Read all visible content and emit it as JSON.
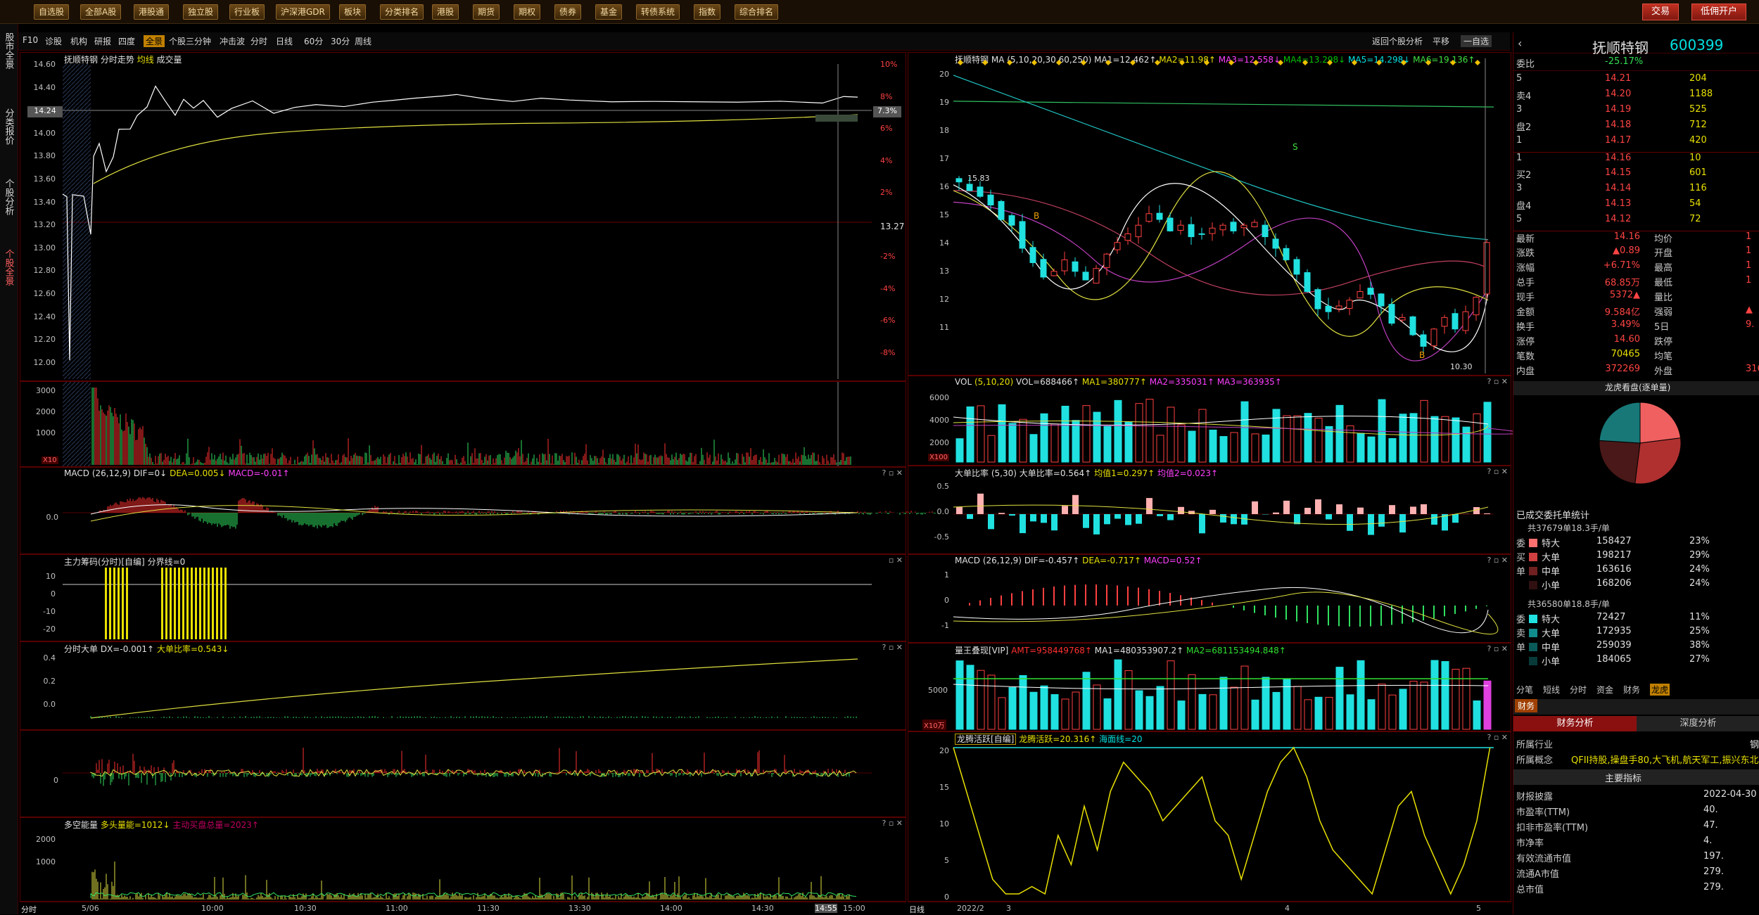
{
  "toolbar": {
    "items": [
      "自选股",
      "全部A股",
      "港股通",
      "独立股",
      "行业板",
      "沪深港GDR",
      "板块",
      "分类排名",
      "港股",
      "期货",
      "期权",
      "债券",
      "基金",
      "转债系统",
      "指数",
      "综合排名"
    ],
    "trade": "交易",
    "open_account": "低佣开户"
  },
  "left_nav": {
    "tabs": [
      "股市全景",
      "分类报价",
      "个股分析",
      "个股全景"
    ]
  },
  "row2": {
    "items": [
      "F10",
      "诊股",
      "机构",
      "研报",
      "四度",
      "全景",
      "个股三分钟",
      "冲击波",
      "分时",
      "日线",
      "60分",
      "30分",
      "周线"
    ],
    "right": [
      "返回个股分析",
      "平移",
      "一自选"
    ]
  },
  "intraday": {
    "title": "抚顺特钢",
    "sub1": "分时走势",
    "sub2": "均线",
    "sub3": "成交量",
    "price_ticks": [
      "14.60",
      "14.40",
      "14.20",
      "14.00",
      "13.80",
      "13.60",
      "13.40",
      "13.20",
      "13.00",
      "12.80",
      "12.60",
      "12.40",
      "12.20",
      "12.00"
    ],
    "pct_ticks": [
      "10%",
      "8%",
      "6%",
      "4%",
      "2%",
      "",
      "-2%",
      "-4%",
      "-6%",
      "-8%"
    ],
    "last_price": "14.24",
    "last_pct": "7.3%",
    "prev_close": "13.27",
    "vol_ticks": [
      "3000",
      "2000",
      "1000"
    ],
    "vol_unit": "X10",
    "macd_title": "MACD",
    "macd_params": "(26,12,9)",
    "macd_dif": "DIF=0↓",
    "macd_dea": "DEA=0.005↓",
    "macd_macd": "MACD=-0.01↑",
    "macd_tick": "0.0",
    "chip_title": "主力筹码(分时)[自编]",
    "chip_val": "分界线=0",
    "chip_ticks": [
      "10",
      "0",
      "-10",
      "-20"
    ],
    "big_title": "分时大单",
    "big_dx": "DX=-0.001↑",
    "big_ratio": "大单比率=0.543↓",
    "big_ticks": [
      "0.4",
      "0.2",
      "0.0"
    ],
    "osc_tick": "0",
    "dk_title": "多空能量",
    "dk_long": "多头量能=1012↓",
    "dk_short": "主动买盘总量=2023↑",
    "dk_ticks": [
      "2000",
      "1000"
    ],
    "x_ticks": [
      "5/06",
      "10:00",
      "10:30",
      "11:00",
      "11:30",
      "13:30",
      "14:00",
      "14:30",
      "14:55",
      "15:00"
    ],
    "x_label": "分时"
  },
  "daily": {
    "title": "抚顺特钢",
    "ma_label": "MA",
    "ma_params": "(5,10,20,30,60,250)",
    "ma": [
      "MA1=12.462↑",
      "MA2=11.98↑",
      "MA3=12.558↓",
      "MA4=13.298↓",
      "MA5=14.298↓",
      "MA6=19.136↑"
    ],
    "price_ticks": [
      "20",
      "19",
      "18",
      "17",
      "16",
      "15",
      "14",
      "13",
      "12",
      "11"
    ],
    "high_label": "15.83",
    "low_label": "10.30",
    "vol_title": "VOL",
    "vol_params": "(5,10,20)",
    "vol_vals": [
      "VOL=688466↑",
      "MA1=380777↑",
      "MA2=335031↑",
      "MA3=363935↑"
    ],
    "vol_ticks": [
      "6000",
      "4000",
      "2000"
    ],
    "vol_unit": "X100",
    "big_title": "大单比率",
    "big_params": "(5,30)",
    "big_vals": [
      "大单比率=0.564↑",
      "均值1=0.297↑",
      "均值2=0.023↑"
    ],
    "big_ticks": [
      "0.5",
      "0.0",
      "-0.5"
    ],
    "macd_title": "MACD",
    "macd_params": "(26,12,9)",
    "macd_vals": [
      "DIF=-0.457↑",
      "DEA=-0.717↑",
      "MACD=0.52↑"
    ],
    "macd_ticks": [
      "1",
      "0",
      "-1"
    ],
    "lw_title": "量王叠现[VIP]",
    "lw_vals": [
      "AMT=958449768↑",
      "MA1=480353907.2↑",
      "MA2=681153494.848↑"
    ],
    "lw_ticks": [
      "5000"
    ],
    "lw_unit": "X10万",
    "lt_title": "龙腾活跃[自编]",
    "lt_vals": [
      "龙腾活跃=20.316↑",
      "海面线=20"
    ],
    "lt_ticks": [
      "20",
      "15",
      "10",
      "5",
      "0"
    ],
    "x_ticks": [
      "2022/2",
      "3",
      "4",
      "5"
    ],
    "x_label": "日线"
  },
  "right_panel": {
    "name": "抚顺特钢",
    "code": "600399",
    "weibi_label": "委比",
    "weibi": "-25.17%",
    "weibi_val": "",
    "ask_labels": [
      "5",
      "卖4",
      "3",
      "盘2",
      "1"
    ],
    "asks": [
      [
        "14.21",
        "204"
      ],
      [
        "14.20",
        "1188"
      ],
      [
        "14.19",
        "525"
      ],
      [
        "14.18",
        "712"
      ],
      [
        "14.17",
        "420"
      ]
    ],
    "bid_labels": [
      "1",
      "买2",
      "3",
      "盘4",
      "5"
    ],
    "bids": [
      [
        "14.16",
        "10"
      ],
      [
        "14.15",
        "601"
      ],
      [
        "14.14",
        "116"
      ],
      [
        "14.13",
        "54"
      ],
      [
        "14.12",
        "72"
      ]
    ],
    "stats": [
      [
        "最新",
        "14.16",
        "均价",
        "1"
      ],
      [
        "涨跌",
        "▲0.89",
        "开盘",
        "1"
      ],
      [
        "涨幅",
        "+6.71%",
        "最高",
        "1"
      ],
      [
        "总手",
        "68.85万",
        "最低",
        "1"
      ],
      [
        "现手",
        "5372▲",
        "量比",
        ""
      ],
      [
        "金额",
        "9.584亿",
        "强弱",
        "▲"
      ],
      [
        "换手",
        "3.49%",
        "5日",
        "9."
      ],
      [
        "涨停",
        "14.60",
        "跌停",
        ""
      ],
      [
        "笔数",
        "70465",
        "均笔",
        ""
      ],
      [
        "内盘",
        "372269",
        "外盘",
        "316"
      ]
    ],
    "dragon_title": "龙虎看盘(逐单量)",
    "pie": [
      {
        "name": "特大",
        "pct": 23,
        "color": "#f06060"
      },
      {
        "name": "大单",
        "pct": 29,
        "color": "#b03030"
      },
      {
        "name": "中单",
        "pct": 24,
        "color": "#4a1818"
      },
      {
        "name": "小单",
        "pct": 24,
        "color": "#187878"
      }
    ],
    "stat_title": "已成交委托单统计",
    "buy_total": "共37679单18.3手/单",
    "buy_rows": [
      [
        "委",
        "特大",
        "158427",
        "23%"
      ],
      [
        "买",
        "大单",
        "198217",
        "29%"
      ],
      [
        "单",
        "中单",
        "163616",
        "24%"
      ],
      [
        "",
        "小单",
        "168206",
        "24%"
      ]
    ],
    "sell_total": "共36580单18.8手/单",
    "sell_rows": [
      [
        "委",
        "特大",
        "72427",
        "11%"
      ],
      [
        "卖",
        "大单",
        "172935",
        "25%"
      ],
      [
        "单",
        "中单",
        "259039",
        "38%"
      ],
      [
        "",
        "小单",
        "184065",
        "27%"
      ]
    ],
    "tabs": [
      "分笔",
      "短线",
      "分时",
      "资金",
      "财务",
      "龙虎"
    ],
    "fin_tab": "财务",
    "fin_sub": [
      "财务分析",
      "深度分析"
    ],
    "industry_label": "所属行业",
    "industry": "钢",
    "concept_label": "所属概念",
    "concept": "QFII持股,操盘手80,大飞机,航天军工,振兴东北",
    "main_index": "主要指标",
    "fin": [
      [
        "财报披露",
        "2022-04-30"
      ],
      [
        "市盈率(TTM)",
        "40."
      ],
      [
        "扣非市盈率(TTM)",
        "47."
      ],
      [
        "市净率",
        "4."
      ],
      [
        "有效流通市值",
        "197."
      ],
      [
        "流通A市值",
        "279."
      ],
      [
        "总市值",
        "279."
      ]
    ]
  }
}
